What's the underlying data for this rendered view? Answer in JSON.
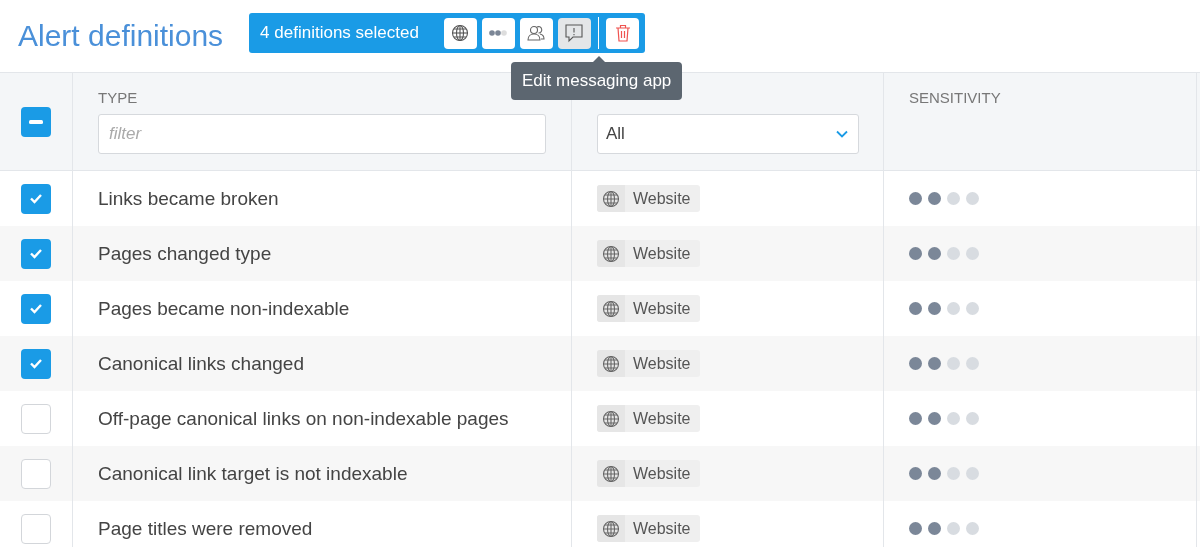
{
  "page": {
    "title": "Alert definitions"
  },
  "selection_bar": {
    "label": "4 definitions selected",
    "actions": [
      {
        "kind": "globe",
        "pressed": false
      },
      {
        "kind": "dots",
        "pressed": false
      },
      {
        "kind": "users",
        "pressed": false
      },
      {
        "kind": "message",
        "pressed": true
      },
      {
        "kind": "trash",
        "pressed": false
      }
    ]
  },
  "tooltip": {
    "text": "Edit messaging app"
  },
  "table": {
    "select_all": {
      "partial": true
    },
    "columns": [
      {
        "label": "TYPE",
        "filter": {
          "kind": "text",
          "placeholder": "filter"
        }
      },
      {
        "filter": {
          "kind": "select",
          "value": "All"
        }
      },
      {
        "label": "SENSITIVITY"
      }
    ],
    "rows": [
      {
        "checked": true,
        "type": "Links became broken",
        "scope": "Website",
        "stars": 2
      },
      {
        "checked": true,
        "type": "Pages changed type",
        "scope": "Website",
        "stars": 2
      },
      {
        "checked": true,
        "type": "Pages became non-indexable",
        "scope": "Website",
        "stars": 2
      },
      {
        "checked": true,
        "type": "Canonical links changed",
        "scope": "Website",
        "stars": 2
      },
      {
        "checked": false,
        "type": "Off-page canonical links on non-indexable pages",
        "scope": "Website",
        "stars": 2
      },
      {
        "checked": false,
        "type": "Canonical link target is not indexable",
        "scope": "Website",
        "stars": 2
      },
      {
        "checked": false,
        "type": "Page titles were removed",
        "scope": "Website",
        "stars": 2
      }
    ]
  }
}
